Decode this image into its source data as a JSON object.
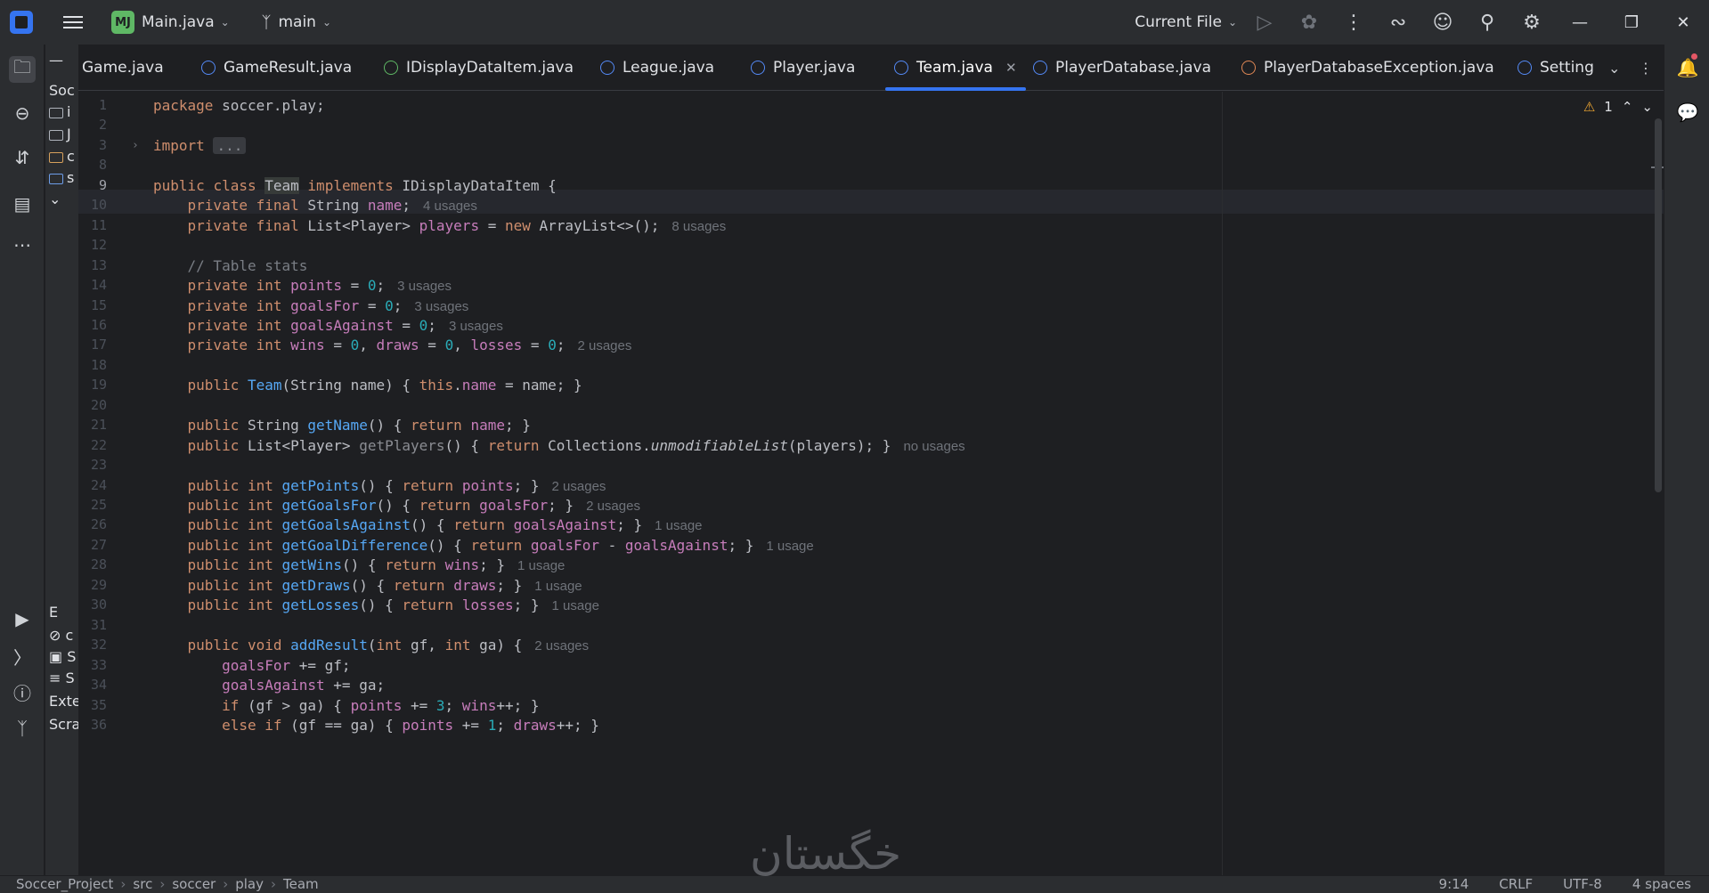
{
  "titlebar": {
    "project_badge": "MJ",
    "project_name": "Main.java",
    "branch": "main",
    "run_config": "Current File"
  },
  "colors": {
    "accent": "#3574f0",
    "keyword": "#cf8e6d",
    "field": "#c77dbb",
    "method": "#56a8f5",
    "number": "#2aacb8",
    "background": "#1e1f22"
  },
  "tabs": [
    {
      "label": "Game.java",
      "icon": "class-icon"
    },
    {
      "label": "GameResult.java",
      "icon": "class-icon"
    },
    {
      "label": "IDisplayDataItem.java",
      "icon": "interface-icon"
    },
    {
      "label": "League.java",
      "icon": "class-icon"
    },
    {
      "label": "Player.java",
      "icon": "class-icon"
    },
    {
      "label": "Team.java",
      "icon": "class-icon",
      "active": true
    },
    {
      "label": "PlayerDatabase.java",
      "icon": "class-icon"
    },
    {
      "label": "PlayerDatabaseException.java",
      "icon": "exception-icon"
    },
    {
      "label": "Setting",
      "icon": "class-icon"
    }
  ],
  "project_panel": {
    "header": "Soc",
    "items": [
      "i",
      "J",
      "c",
      "s",
      "E",
      "c",
      "S",
      "S",
      "Exte",
      "Scra"
    ]
  },
  "editor": {
    "warnings": "1",
    "current_line": "9",
    "lines": [
      {
        "n": "1",
        "code": "package soccer.play;"
      },
      {
        "n": "2",
        "code": ""
      },
      {
        "n": "3",
        "code": "import ..."
      },
      {
        "n": "8",
        "code": ""
      },
      {
        "n": "9",
        "code": "public class Team implements IDisplayDataItem {"
      },
      {
        "n": "10",
        "code": "    private final String name;",
        "hint": "4 usages"
      },
      {
        "n": "11",
        "code": "    private final List<Player> players = new ArrayList<>();",
        "hint": "8 usages"
      },
      {
        "n": "12",
        "code": ""
      },
      {
        "n": "13",
        "code": "    // Table stats"
      },
      {
        "n": "14",
        "code": "    private int points = 0;",
        "hint": "3 usages"
      },
      {
        "n": "15",
        "code": "    private int goalsFor = 0;",
        "hint": "3 usages"
      },
      {
        "n": "16",
        "code": "    private int goalsAgainst = 0;",
        "hint": "3 usages"
      },
      {
        "n": "17",
        "code": "    private int wins = 0, draws = 0, losses = 0;",
        "hint": "2 usages"
      },
      {
        "n": "18",
        "code": ""
      },
      {
        "n": "19",
        "code": "    public Team(String name) { this.name = name; }"
      },
      {
        "n": "20",
        "code": ""
      },
      {
        "n": "21",
        "code": "    public String getName() { return name; }"
      },
      {
        "n": "22",
        "code": "    public List<Player> getPlayers() { return Collections.unmodifiableList(players); }",
        "hint": "no usages"
      },
      {
        "n": "23",
        "code": ""
      },
      {
        "n": "24",
        "code": "    public int getPoints() { return points; }",
        "hint": "2 usages"
      },
      {
        "n": "25",
        "code": "    public int getGoalsFor() { return goalsFor; }",
        "hint": "2 usages"
      },
      {
        "n": "26",
        "code": "    public int getGoalsAgainst() { return goalsAgainst; }",
        "hint": "1 usage"
      },
      {
        "n": "27",
        "code": "    public int getGoalDifference() { return goalsFor - goalsAgainst; }",
        "hint": "1 usage"
      },
      {
        "n": "28",
        "code": "    public int getWins() { return wins; }",
        "hint": "1 usage"
      },
      {
        "n": "29",
        "code": "    public int getDraws() { return draws; }",
        "hint": "1 usage"
      },
      {
        "n": "30",
        "code": "    public int getLosses() { return losses; }",
        "hint": "1 usage"
      },
      {
        "n": "31",
        "code": ""
      },
      {
        "n": "32",
        "code": "    public void addResult(int gf, int ga) {",
        "hint": "2 usages"
      },
      {
        "n": "33",
        "code": "        goalsFor += gf;"
      },
      {
        "n": "34",
        "code": "        goalsAgainst += ga;"
      },
      {
        "n": "35",
        "code": "        if (gf > ga) { points += 3; wins++; }"
      },
      {
        "n": "36",
        "code": "        else if (gf == ga) { points += 1; draws++; }"
      }
    ]
  },
  "statusbar": {
    "breadcrumbs": [
      "Soccer_Project",
      "src",
      "soccer",
      "play",
      "Team"
    ],
    "position": "9:14",
    "line_separator": "CRLF",
    "encoding": "UTF-8",
    "indent": "4 spaces"
  },
  "watermark": "خگستان"
}
